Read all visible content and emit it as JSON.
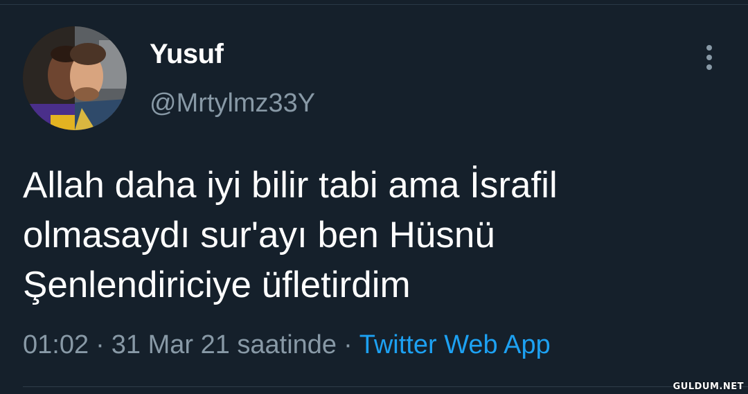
{
  "tweet": {
    "author": {
      "display_name": "Yusuf",
      "handle": "@Mrtylmz33Y",
      "avatar_icon": "avatar-photo"
    },
    "text": "Allah daha iyi bilir tabi ama İsrafil\nolmasaydı sur'ayı ben Hüsnü\nŞenlendiriciye üfletirdim",
    "time": "01:02",
    "separator": "·",
    "date": "31 Mar 21 saatinde",
    "source": "Twitter Web App",
    "more_icon": "more-vertical-icon"
  },
  "watermark": "GULDUM.NET",
  "colors": {
    "background": "#15202b",
    "text_primary": "#ffffff",
    "text_secondary": "#8899a6",
    "accent": "#1da1f2"
  }
}
